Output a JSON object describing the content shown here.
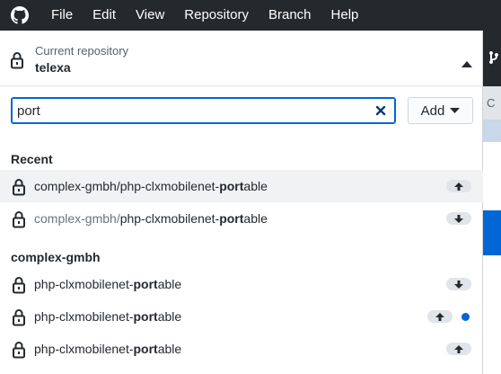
{
  "menu": {
    "items": [
      "File",
      "Edit",
      "View",
      "Repository",
      "Branch",
      "Help"
    ]
  },
  "repo_header": {
    "caption": "Current repository",
    "name": "telexa"
  },
  "filter": {
    "value": "port",
    "add_label": "Add"
  },
  "sections": {
    "recent_title": "Recent",
    "org_title": "complex-gmbh"
  },
  "recent": [
    {
      "owner": "complex-gmbh/",
      "prefix": "php-clxmobilenet-",
      "match": "port",
      "suffix": "able",
      "sync": "push",
      "selected": true
    },
    {
      "owner": "complex-gmbh/",
      "prefix": "php-clxmobilenet-",
      "match": "port",
      "suffix": "able",
      "sync": "pull",
      "selected": false
    }
  ],
  "org_repos": [
    {
      "prefix": "php-clxmobilenet-",
      "match": "port",
      "suffix": "able",
      "sync": "pull",
      "changes": false
    },
    {
      "prefix": "php-clxmobilenet-",
      "match": "port",
      "suffix": "able",
      "sync": "push",
      "changes": true
    },
    {
      "prefix": "php-clxmobilenet-",
      "match": "port",
      "suffix": "able",
      "sync": "push",
      "changes": false
    }
  ],
  "colors": {
    "menubar": "#24292e",
    "accent": "#0366d6",
    "selected_row": "#f1f2f4"
  },
  "icons": {
    "logo": "github-logo-icon",
    "lock": "lock-icon",
    "caret": "caret-up-icon",
    "clear": "clear-x-icon",
    "push": "arrow-up-icon",
    "pull": "arrow-down-icon"
  }
}
